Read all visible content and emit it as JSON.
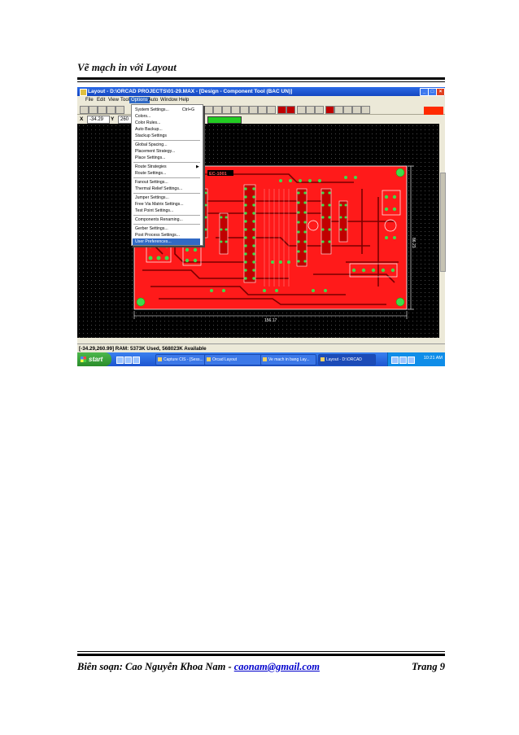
{
  "header": {
    "title": "Vẽ mạch in với Layout"
  },
  "window": {
    "title": "Layout - D:\\ORCAD PROJECTS\\01-29.MAX - [Design - Component Tool (BAC UN)]",
    "controls": [
      "_",
      "□",
      "×"
    ]
  },
  "menubar": [
    "File",
    "Edit",
    "View",
    "Tool",
    "Options",
    "Auto",
    "Window",
    "Help"
  ],
  "coords": {
    "x_label": "X",
    "x_value": "-34.29",
    "y_label": "Y",
    "y_value": "260"
  },
  "options_menu": [
    {
      "label": "System Settings...",
      "shortcut": "Ctrl+G"
    },
    {
      "label": "Colors..."
    },
    {
      "label": "Color Rules..."
    },
    {
      "label": "Auto Backup..."
    },
    {
      "label": "Stackup Settings"
    },
    {
      "label": "Global Spacing..."
    },
    {
      "label": "Placement Strategy..."
    },
    {
      "label": "Place Settings..."
    },
    {
      "label": "Route Strategies",
      "submenu": "▶"
    },
    {
      "label": "Route Settings..."
    },
    {
      "label": "Fanout Settings..."
    },
    {
      "label": "Thermal Relief Settings..."
    },
    {
      "label": "Jumper Settings..."
    },
    {
      "label": "Free Via Matrix Settings..."
    },
    {
      "label": "Test Point Settings..."
    },
    {
      "label": "Components Renaming..."
    },
    {
      "label": "Gerber Settings..."
    },
    {
      "label": "Post Process Settings..."
    },
    {
      "label": "User Preferences..."
    }
  ],
  "board": {
    "label": "EC-1001",
    "dim_bottom": "156.17",
    "dim_right": "86.23"
  },
  "statusbar": {
    "text": "[-34.29,260.99]  RAM: 5373K Used, 568023K Available"
  },
  "taskbar": {
    "start": "start",
    "tasks": [
      "Capture CIS - [Sess...",
      "Orcad Layout",
      "Ve mach in bang Lay...",
      "Layout - D:\\ORCAD"
    ],
    "clock": "10:21 AM"
  },
  "footer": {
    "author": "Biên soạn: Cao Nguyễn Khoa Nam - ",
    "email": "caonam@gmail.com",
    "page": "Trang 9"
  },
  "colors": {
    "pcb_red": "#ff1a1a",
    "pad_green": "#3fdc4a",
    "menu_highlight": "#316ac5"
  }
}
